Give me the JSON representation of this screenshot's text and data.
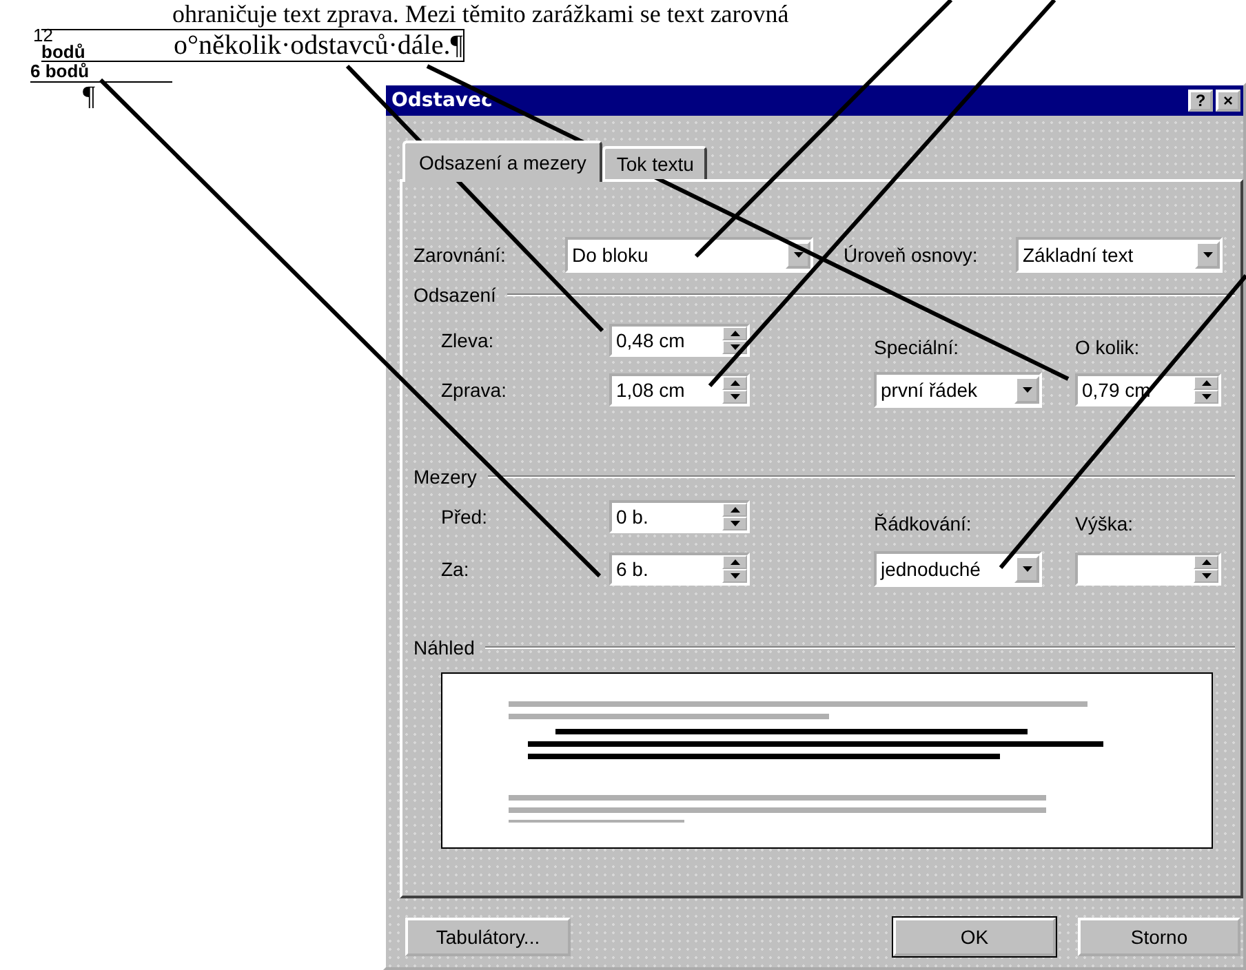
{
  "document": {
    "top_line": "ohraničuje text zprava. Mezi těmito zarážkami se text zarovná",
    "before_mark": {
      "number": "12",
      "unit": "bodů"
    },
    "paragraph_text": "o°několik·odstavců·dále.",
    "paragraph_mark": "¶",
    "after_mark": "6 bodů",
    "empty_paragraph_mark": "¶"
  },
  "dialog": {
    "title": "Odstavec",
    "title_buttons": [
      "?",
      "×"
    ],
    "tabs": [
      {
        "label": "Odsazení a mezery",
        "selected": true
      },
      {
        "label": "Tok textu",
        "selected": false
      }
    ],
    "alignment": {
      "label": "Zarovnání:",
      "value": "Do bloku"
    },
    "outline_level": {
      "label": "Úroveň osnovy:",
      "value": "Základní text"
    },
    "indent": {
      "title": "Odsazení",
      "left": {
        "label": "Zleva:",
        "value": "0,48 cm"
      },
      "right": {
        "label": "Zprava:",
        "value": "1,08 cm"
      },
      "special": {
        "label": "Speciální:",
        "value": "první řádek"
      },
      "by": {
        "label": "O kolik:",
        "value": "0,79 cm"
      }
    },
    "spacing": {
      "title": "Mezery",
      "before": {
        "label": "Před:",
        "value": "0 b."
      },
      "after": {
        "label": "Za:",
        "value": "6 b."
      },
      "line_spacing": {
        "label": "Řádkování:",
        "value": "jednoduché"
      },
      "at": {
        "label": "Výška:"
      }
    },
    "preview": {
      "title": "Náhled"
    },
    "buttons": [
      {
        "label": "Tabulátory...",
        "default": false
      },
      {
        "label": "OK",
        "default": true
      },
      {
        "label": "Storno",
        "default": false
      }
    ]
  }
}
